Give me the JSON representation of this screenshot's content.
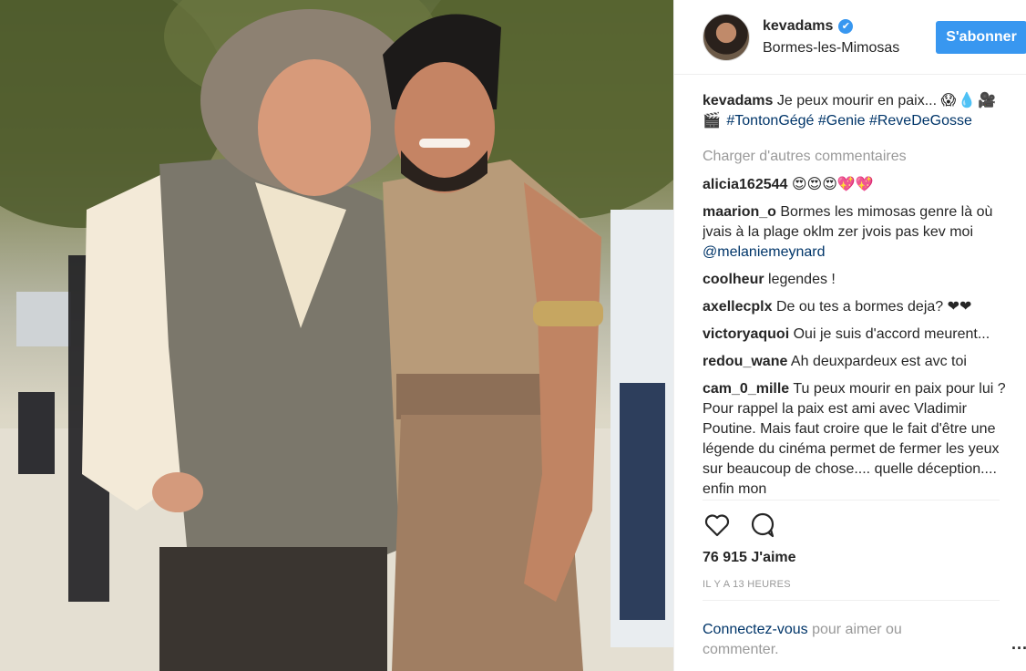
{
  "post": {
    "username": "kevadams",
    "verified_badge": "✔",
    "location": "Bormes-les-Mimosas",
    "follow_label": "S'abonner",
    "caption_text": "Je peux mourir en paix...",
    "caption_emoji": "😱💧🎥🎬",
    "hashtags": [
      "#TontonGégé",
      "#Genie",
      "#ReveDeGosse"
    ],
    "load_more": "Charger d'autres commentaires",
    "likes": "76 915 J'aime",
    "time": "IL Y A 13 HEURES"
  },
  "comments": [
    {
      "user": "alicia162544",
      "text": "😍😍😍💖💖"
    },
    {
      "user": "maarion_o",
      "text": "Bormes les mimosas genre là où jvais à la plage oklm zer jvois pas kev moi",
      "mention": "@melaniemeynard"
    },
    {
      "user": "coolheur",
      "text": "legendes !"
    },
    {
      "user": "axellecplx",
      "text": "De ou tes a bormes deja? ❤❤"
    },
    {
      "user": "victoryaquoi",
      "text": "Oui je suis d'accord meurent..."
    },
    {
      "user": "redou_wane",
      "text": "Ah deuxpardeux est avc toi"
    },
    {
      "user": "cam_0_mille",
      "text": "Tu peux mourir en paix pour lui ? Pour rappel la paix est ami avec Vladimir Poutine. Mais faut croire que le fait d'être une légende du cinéma permet de fermer les yeux sur beaucoup de chose.... quelle déception.... enfin mon"
    }
  ],
  "footer": {
    "login_link": "Connectez-vous",
    "login_rest": "pour aimer ou commenter.",
    "more": "..."
  },
  "icons": {
    "like": "heart-icon",
    "comment": "speech-bubble-icon",
    "more": "ellipsis-icon"
  },
  "colors": {
    "accent": "#3897f0",
    "link": "#003569",
    "muted": "#999999"
  }
}
